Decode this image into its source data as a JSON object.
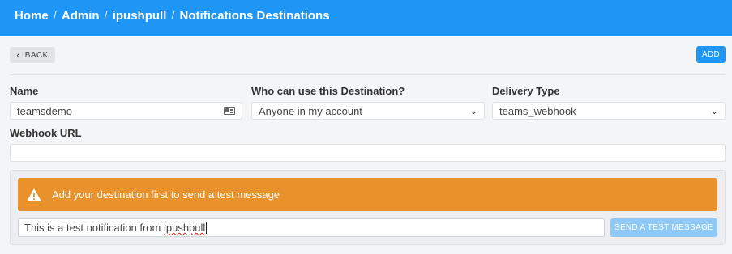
{
  "breadcrumb": {
    "items": [
      "Home",
      "Admin",
      "ipushpull",
      "Notifications Destinations"
    ],
    "separator": "/"
  },
  "toolbar": {
    "back_label": "BACK",
    "add_label": "ADD"
  },
  "form": {
    "name": {
      "label": "Name",
      "value": "teamsdemo"
    },
    "who": {
      "label": "Who can use this Destination?",
      "value": "Anyone in my account"
    },
    "delivery": {
      "label": "Delivery Type",
      "value": "teams_webhook"
    },
    "webhook": {
      "label": "Webhook URL",
      "value": ""
    }
  },
  "test": {
    "alert_text": "Add your destination first to send a test message",
    "message_prefix": "This is a test notification from ",
    "message_word": "ipushpull",
    "send_label": "SEND A TEST MESSAGE"
  },
  "icons": {
    "back": "chevron-left-icon",
    "name_field": "id-card-icon",
    "select": "chevron-down-icon",
    "alert": "warning-icon"
  },
  "colors": {
    "header": "#1e96f5",
    "primary": "#1e96f5",
    "alert": "#e9922b",
    "disabled_button": "#8fc9f8"
  }
}
